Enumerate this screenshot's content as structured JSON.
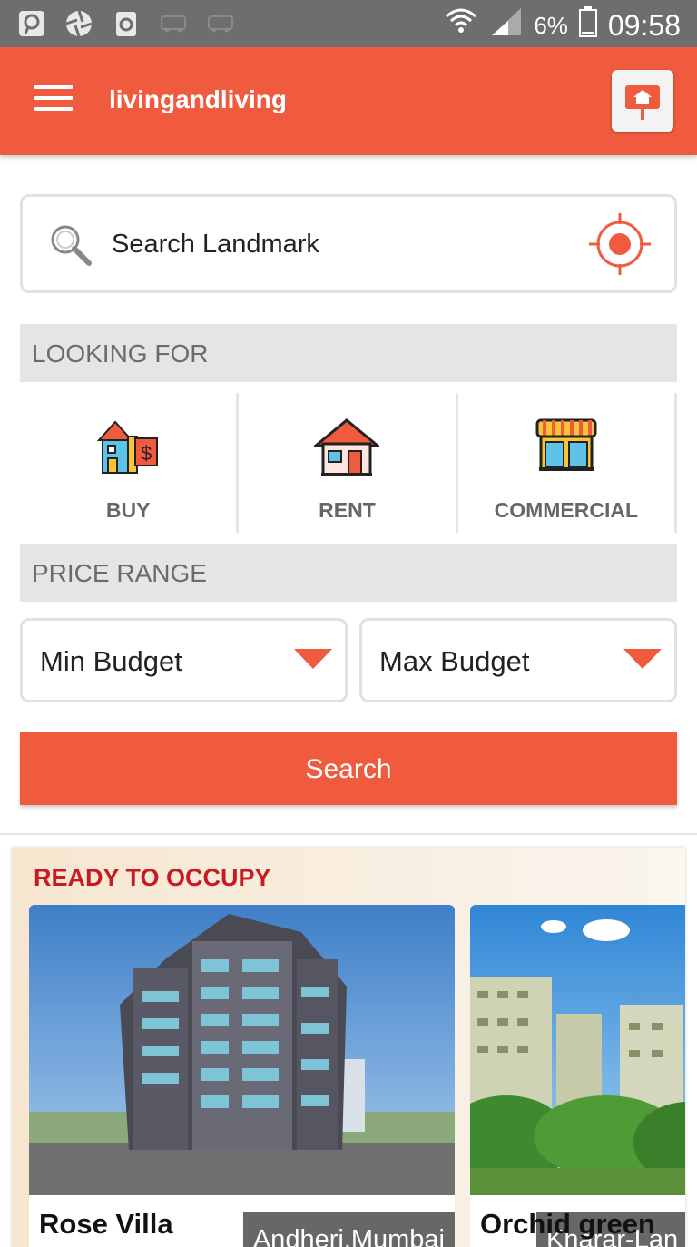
{
  "status_bar": {
    "battery": "6%",
    "time": "09:58"
  },
  "app_bar": {
    "title": "livingandliving"
  },
  "search": {
    "placeholder": "Search Landmark"
  },
  "looking_for": {
    "heading": "LOOKING FOR",
    "options": [
      {
        "label": "BUY",
        "icon": "house-dollar-icon"
      },
      {
        "label": "RENT",
        "icon": "house-icon"
      },
      {
        "label": "COMMERCIAL",
        "icon": "shop-icon"
      }
    ]
  },
  "price_range": {
    "heading": "PRICE RANGE",
    "min_label": "Min Budget",
    "max_label": "Max Budget"
  },
  "search_button": "Search",
  "ready_to_occupy": {
    "heading": "READY TO OCCUPY",
    "properties": [
      {
        "name": "Rose Villa",
        "location": "Andheri,Mumbai"
      },
      {
        "name": "Orchid green",
        "location": "Kharar-Lan"
      }
    ]
  },
  "colors": {
    "primary": "#f05a3e",
    "section_bg": "#e5e5e5",
    "occupy_title": "#c71b24"
  }
}
